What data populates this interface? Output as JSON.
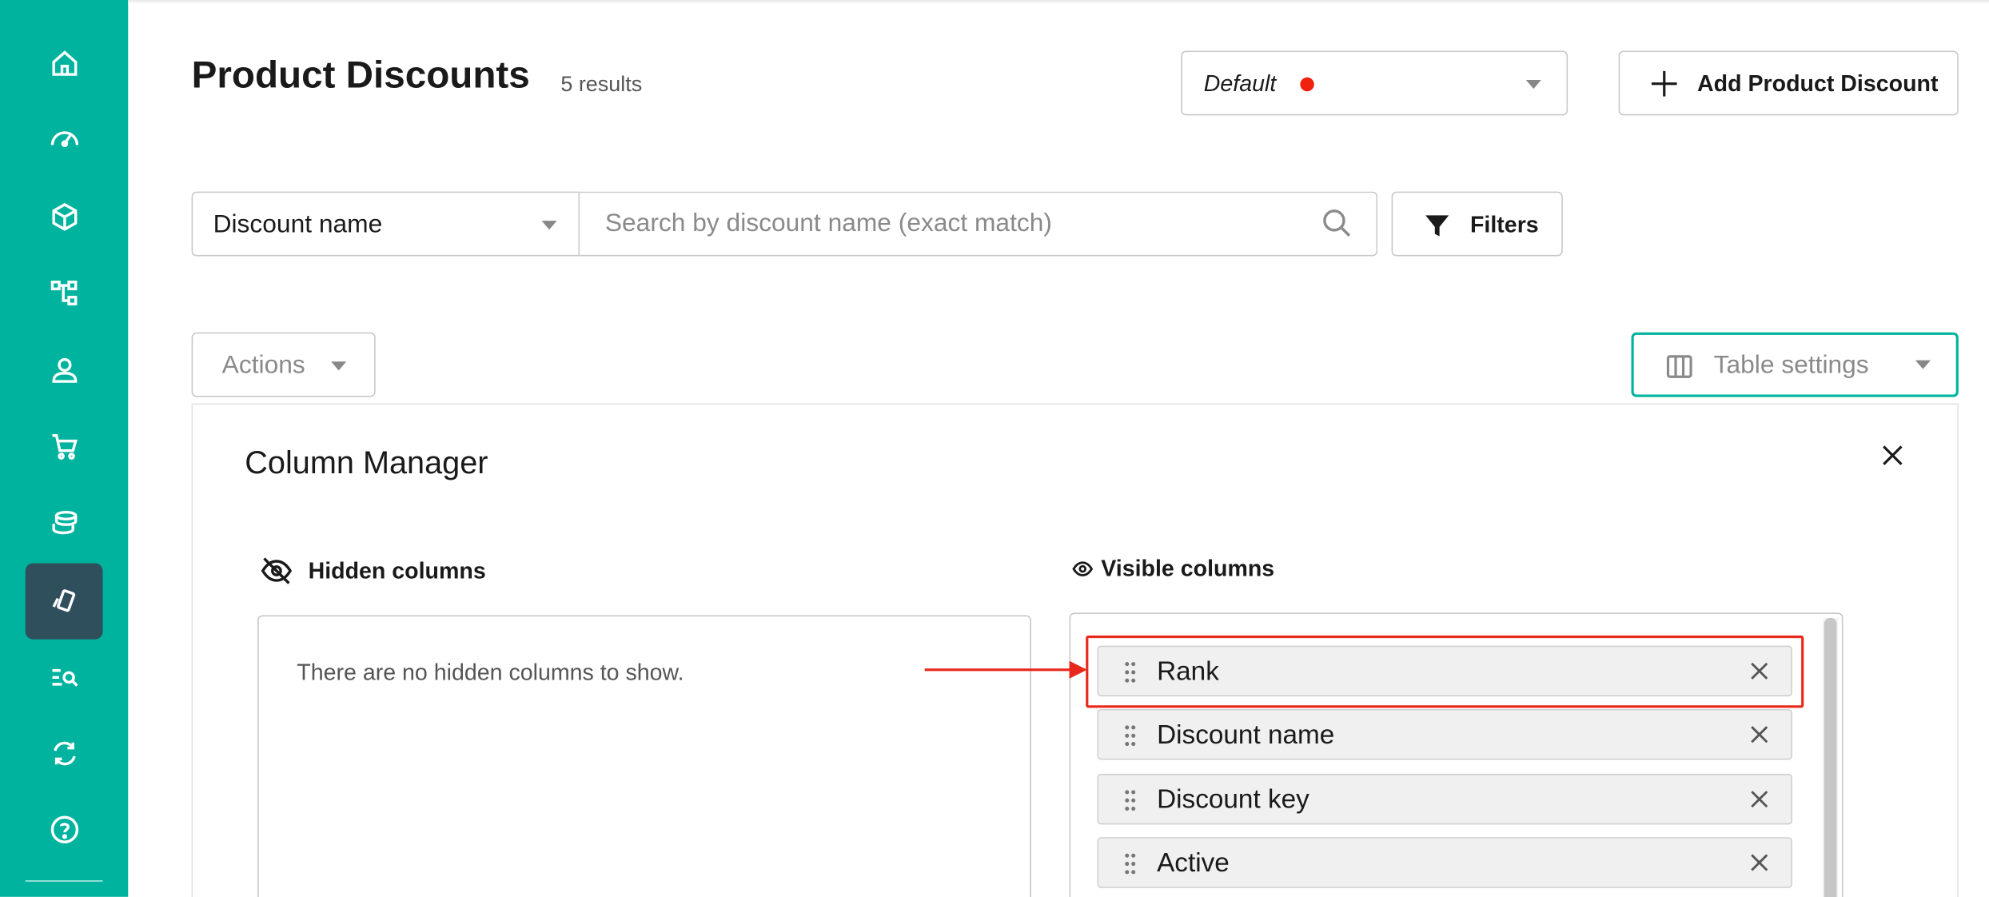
{
  "header": {
    "title": "Product Discounts",
    "result_count": "5 results"
  },
  "project_selector": {
    "value": "Default",
    "status_color": "#f0220f"
  },
  "add_button": {
    "label": "Add Product Discount"
  },
  "search": {
    "field_select_value": "Discount name",
    "placeholder": "Search by discount name (exact match)",
    "value": ""
  },
  "filters_button": {
    "label": "Filters"
  },
  "actions_button": {
    "label": "Actions"
  },
  "table_settings": {
    "label": "Table settings"
  },
  "column_manager": {
    "title": "Column Manager",
    "hidden_columns_label": "Hidden columns",
    "visible_columns_label": "Visible columns",
    "hidden_empty_message": "There are no hidden columns to show.",
    "visible_columns": [
      "Rank",
      "Discount name",
      "Discount key",
      "Active"
    ]
  },
  "sidebar": {
    "items": [
      {
        "icon": "home-icon"
      },
      {
        "icon": "dashboard-gauge-icon"
      },
      {
        "icon": "product-box-icon"
      },
      {
        "icon": "category-tree-icon"
      },
      {
        "icon": "customer-user-icon"
      },
      {
        "icon": "cart-icon"
      },
      {
        "icon": "coins-icon"
      },
      {
        "icon": "discount-tag-icon",
        "active": true
      },
      {
        "icon": "search-list-icon"
      },
      {
        "icon": "sync-icon"
      },
      {
        "icon": "help-icon"
      }
    ]
  },
  "colors": {
    "brand": "#00b39e",
    "sidebar_active": "#2f4f5c",
    "annotation": "#e8281a"
  }
}
